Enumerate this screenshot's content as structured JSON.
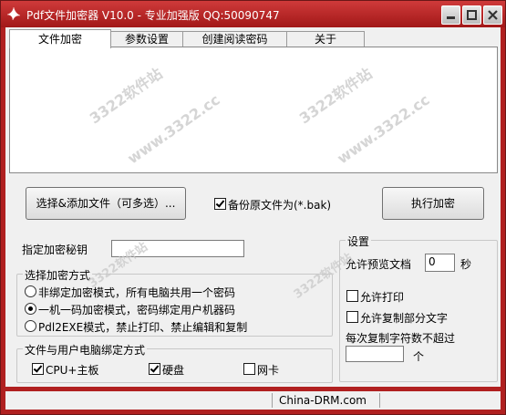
{
  "window": {
    "title": "Pdf文件加密器 V10.0 - 专业加强版 QQ:50090747",
    "minimize_icon": "minimize-icon",
    "maximize_icon": "maximize-icon",
    "close_icon": "close-icon"
  },
  "tabs": [
    "文件加密",
    "参数设置",
    "创建阅读密码",
    "关于"
  ],
  "watermarks": [
    "3322软件站",
    "www.3322.cc"
  ],
  "buttons": {
    "select_files": "选择&添加文件（可多选）...",
    "encrypt": "执行加密"
  },
  "backup_checkbox": {
    "label": "备份原文件为(*.bak)",
    "checked": true
  },
  "key": {
    "label": "指定加密秘钥",
    "value": ""
  },
  "mode_group": {
    "title": "选择加密方式",
    "options": [
      {
        "label": "非绑定加密模式，所有电脑共用一个密码",
        "selected": false
      },
      {
        "label": "一机一码加密模式，密码绑定用户机器码",
        "selected": true
      },
      {
        "label": "Pdl2EXE模式，禁止打印、禁止编辑和复制",
        "selected": false
      }
    ]
  },
  "bind_group": {
    "title": "文件与用户电脑绑定方式",
    "options": [
      {
        "label": "CPU+主板",
        "checked": true
      },
      {
        "label": "硬盘",
        "checked": true
      },
      {
        "label": "网卡",
        "checked": false
      }
    ]
  },
  "settings_group": {
    "title": "设置",
    "preview_label": "允许预览文档",
    "preview_value": "0",
    "preview_unit": "秒",
    "allow_print": {
      "label": "允许打印",
      "checked": false
    },
    "allow_copy": {
      "label": "允许复制部分文字",
      "checked": false
    },
    "copy_limit_label": "每次复制字符数不超过",
    "copy_limit_value": "",
    "copy_limit_unit": "个"
  },
  "statusbar": {
    "text": "China-DRM.com"
  },
  "colors": {
    "titlebar": "#b02020",
    "client": "#f0f0f0",
    "watermark": "#c8c8c8"
  }
}
